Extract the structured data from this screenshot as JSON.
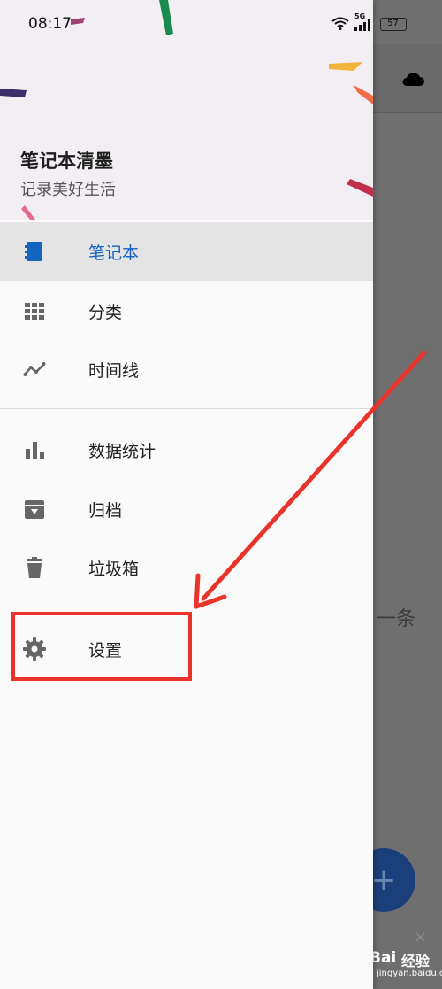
{
  "status_bar": {
    "time": "08:17",
    "network": "5G",
    "battery": "57"
  },
  "drawer": {
    "header": {
      "title": "笔记本清墨",
      "subtitle": "记录美好生活"
    },
    "nav_items": [
      {
        "label": "笔记本",
        "icon": "notebook-icon",
        "active": true
      },
      {
        "label": "分类",
        "icon": "grid-icon"
      },
      {
        "label": "时间线",
        "icon": "timeline-icon"
      },
      {
        "label": "数据统计",
        "icon": "bar-chart-icon"
      },
      {
        "label": "归档",
        "icon": "archive-icon"
      },
      {
        "label": "垃圾箱",
        "icon": "trash-icon"
      },
      {
        "label": "设置",
        "icon": "gear-icon"
      }
    ]
  },
  "background": {
    "empty_text": "一条",
    "fab_label": "+",
    "ad_close": "×"
  },
  "watermark": {
    "brand": "Bai",
    "cn": "经验",
    "url": "jingyan.baidu.com"
  },
  "colors": {
    "accent": "#1565c0",
    "annotation": "#e8342b",
    "scrim": "#6f6f6f"
  }
}
